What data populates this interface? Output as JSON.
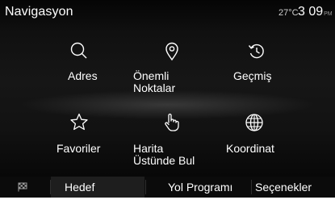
{
  "header": {
    "title": "Navigasyon",
    "temperature": "27°C",
    "time": "3 09",
    "ampm": "PM"
  },
  "menu": {
    "items": [
      {
        "label": "Adres",
        "icon": "search-icon"
      },
      {
        "label": "Önemli\nNoktalar",
        "icon": "poi-pin-icon"
      },
      {
        "label": "Geçmiş",
        "icon": "history-icon"
      },
      {
        "label": "Favoriler",
        "icon": "star-icon"
      },
      {
        "label": "Harita\nÜstünde Bul",
        "icon": "hand-pointer-icon"
      },
      {
        "label": "Koordinat",
        "icon": "globe-icon"
      }
    ]
  },
  "tabs": {
    "flag_icon": "flag-icon",
    "items": [
      {
        "label": "Hedef",
        "selected": true
      },
      {
        "label": "Yol Programı",
        "selected": false
      },
      {
        "label": "Seçenekler",
        "selected": false
      }
    ]
  },
  "colors": {
    "background": "#000000",
    "text": "#ffffff",
    "selected_tab": "#1e1e1e",
    "bottom_strip": "#ffffff"
  }
}
